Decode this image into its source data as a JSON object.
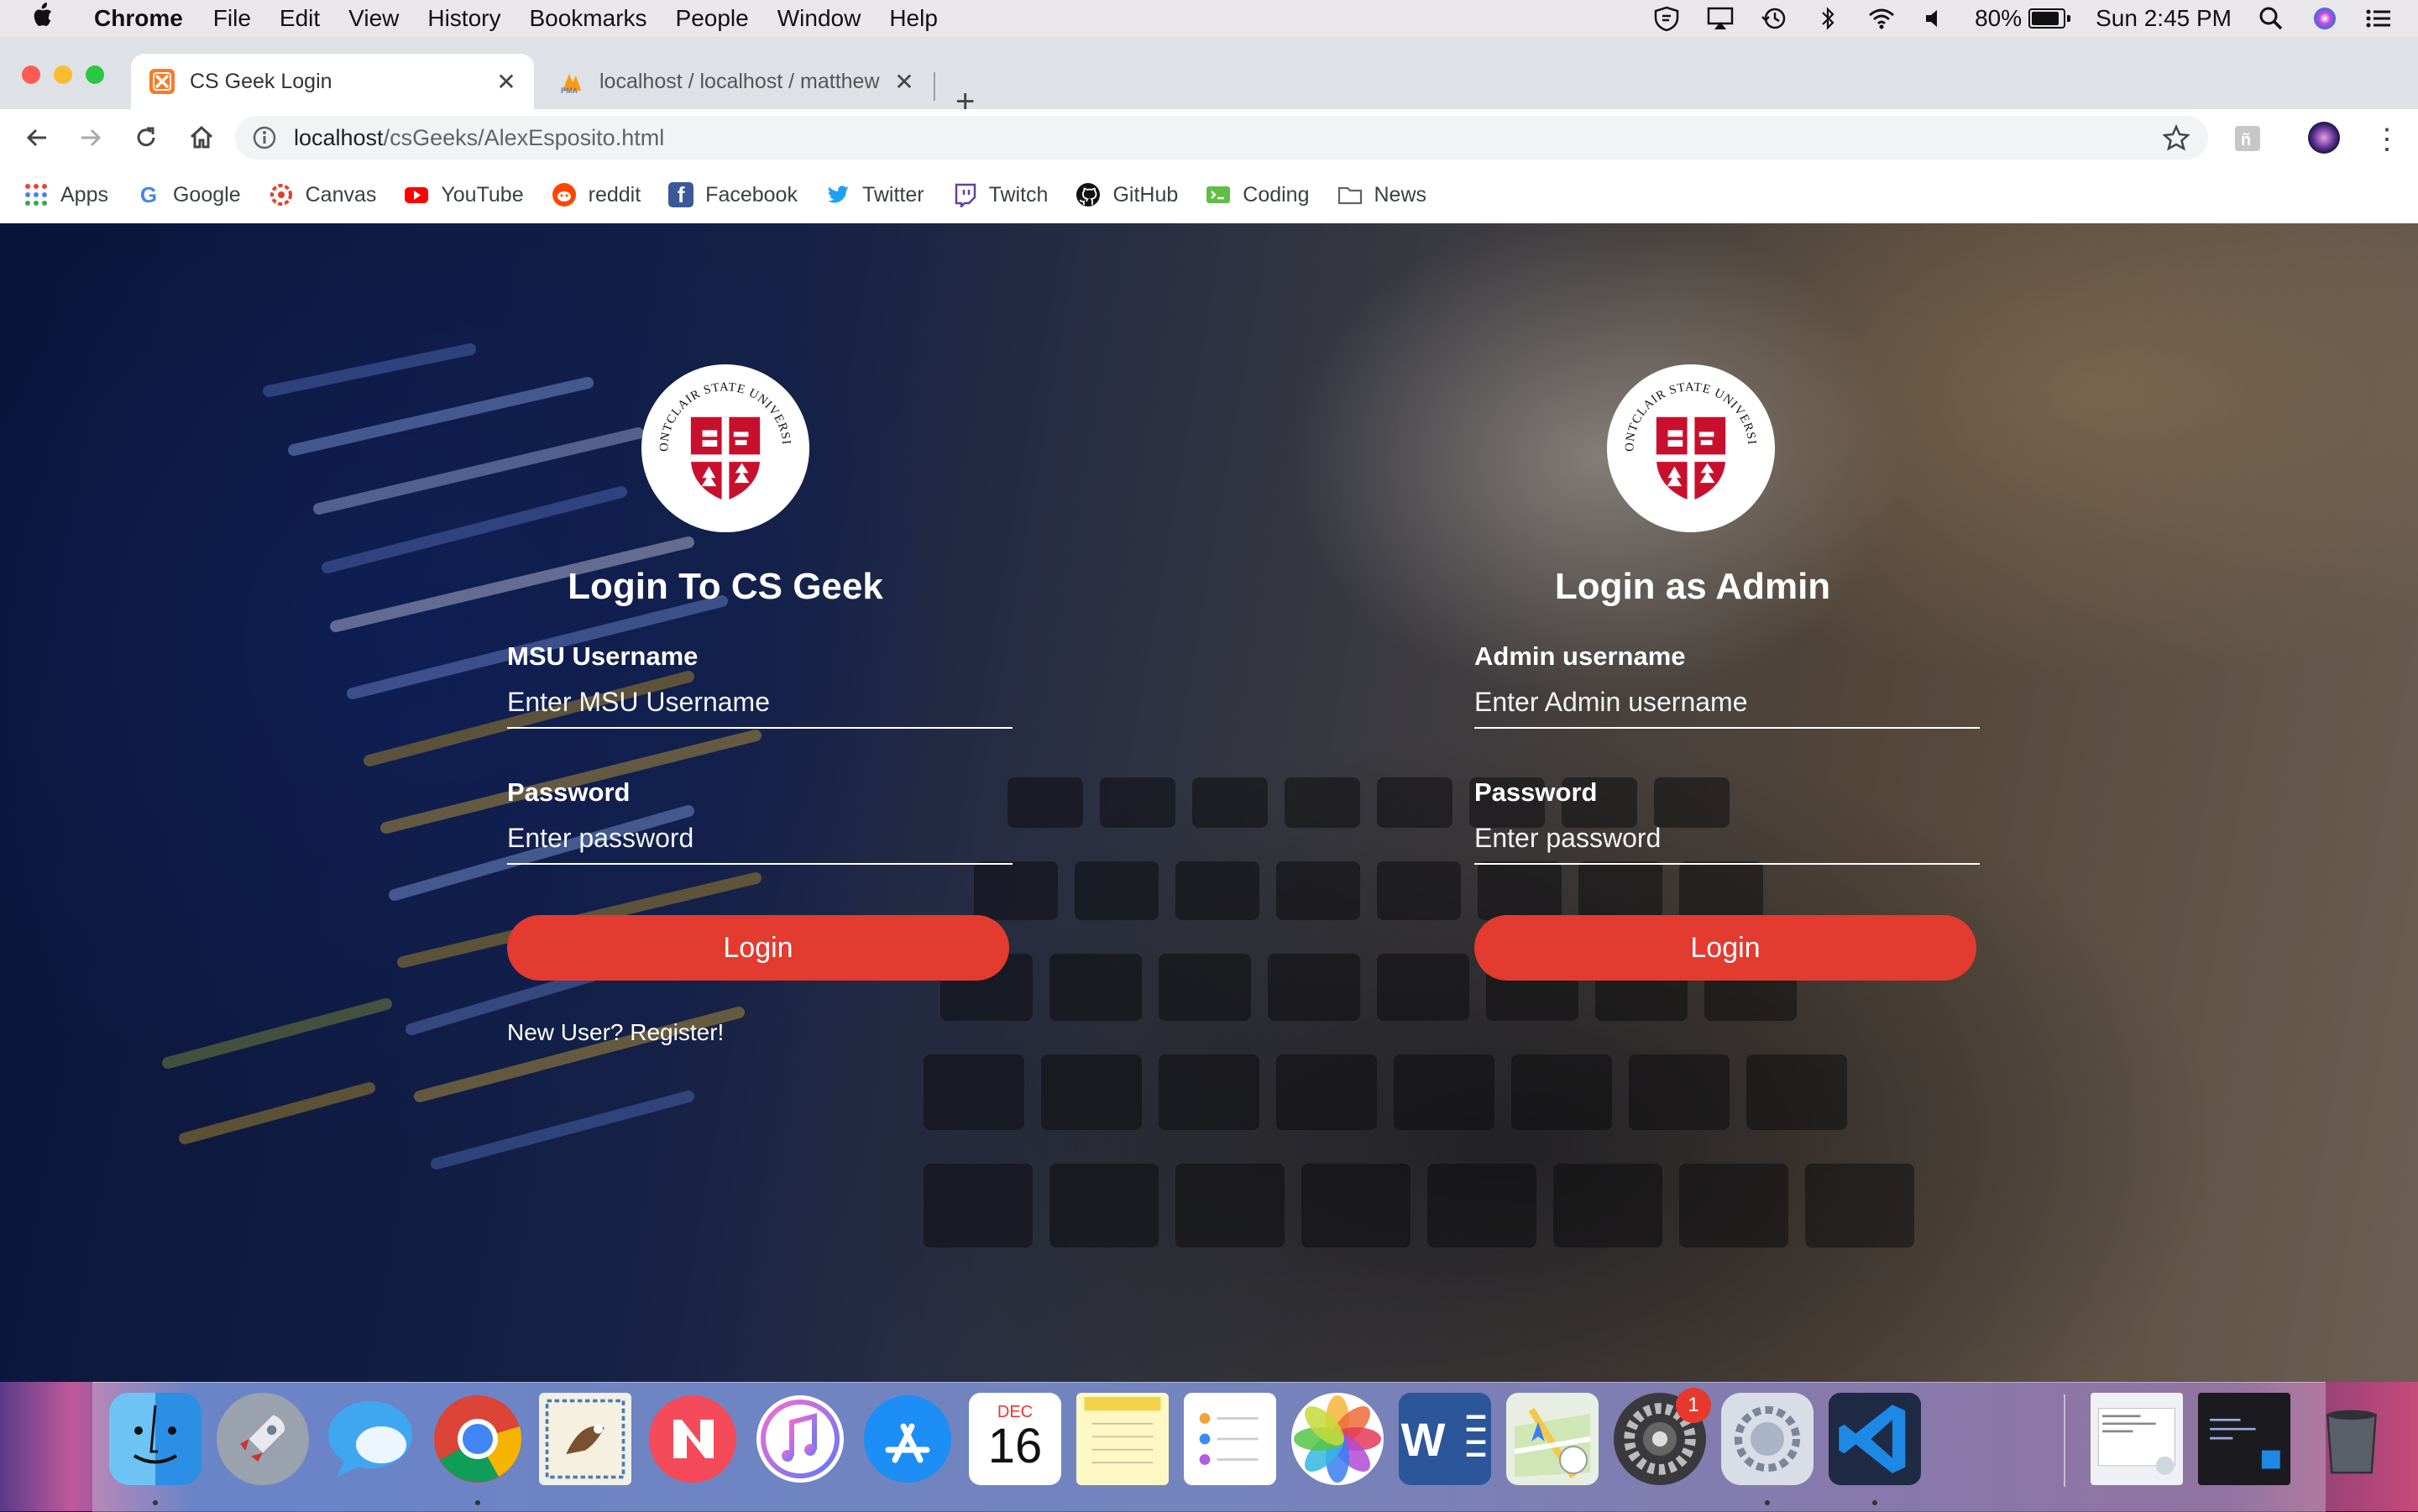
{
  "menubar": {
    "app": "Chrome",
    "items": [
      "File",
      "Edit",
      "View",
      "History",
      "Bookmarks",
      "People",
      "Window",
      "Help"
    ],
    "battery": "80%",
    "clock": "Sun 2:45 PM"
  },
  "tabs": [
    {
      "title": "CS Geek Login",
      "favicon": "xampp-icon"
    },
    {
      "title": "localhost / localhost / matthew",
      "favicon": "phpmyadmin-icon"
    }
  ],
  "address": {
    "host": "localhost",
    "path": "/csGeeks/AlexEsposito.html"
  },
  "bookmarks": [
    "Apps",
    "Google",
    "Canvas",
    "YouTube",
    "reddit",
    "Facebook",
    "Twitter",
    "Twitch",
    "GitHub",
    "Coding",
    "News"
  ],
  "logo_text": "MONTCLAIR STATE UNIVERSITY",
  "user_login": {
    "title": "Login To CS Geek",
    "username_label": "MSU Username",
    "username_placeholder": "Enter MSU Username",
    "password_label": "Password",
    "password_placeholder": "Enter password",
    "button": "Login",
    "register": "New User? Register!"
  },
  "admin_login": {
    "title": "Login as Admin",
    "username_label": "Admin username",
    "username_placeholder": "Enter Admin username",
    "password_label": "Password",
    "password_placeholder": "Enter password",
    "button": "Login"
  },
  "dock": {
    "calendar_month": "DEC",
    "calendar_day": "16",
    "word_letter": "W",
    "system_prefs_badge": "1"
  },
  "colors": {
    "accent": "#e33b30",
    "msu_red": "#c8102e"
  }
}
